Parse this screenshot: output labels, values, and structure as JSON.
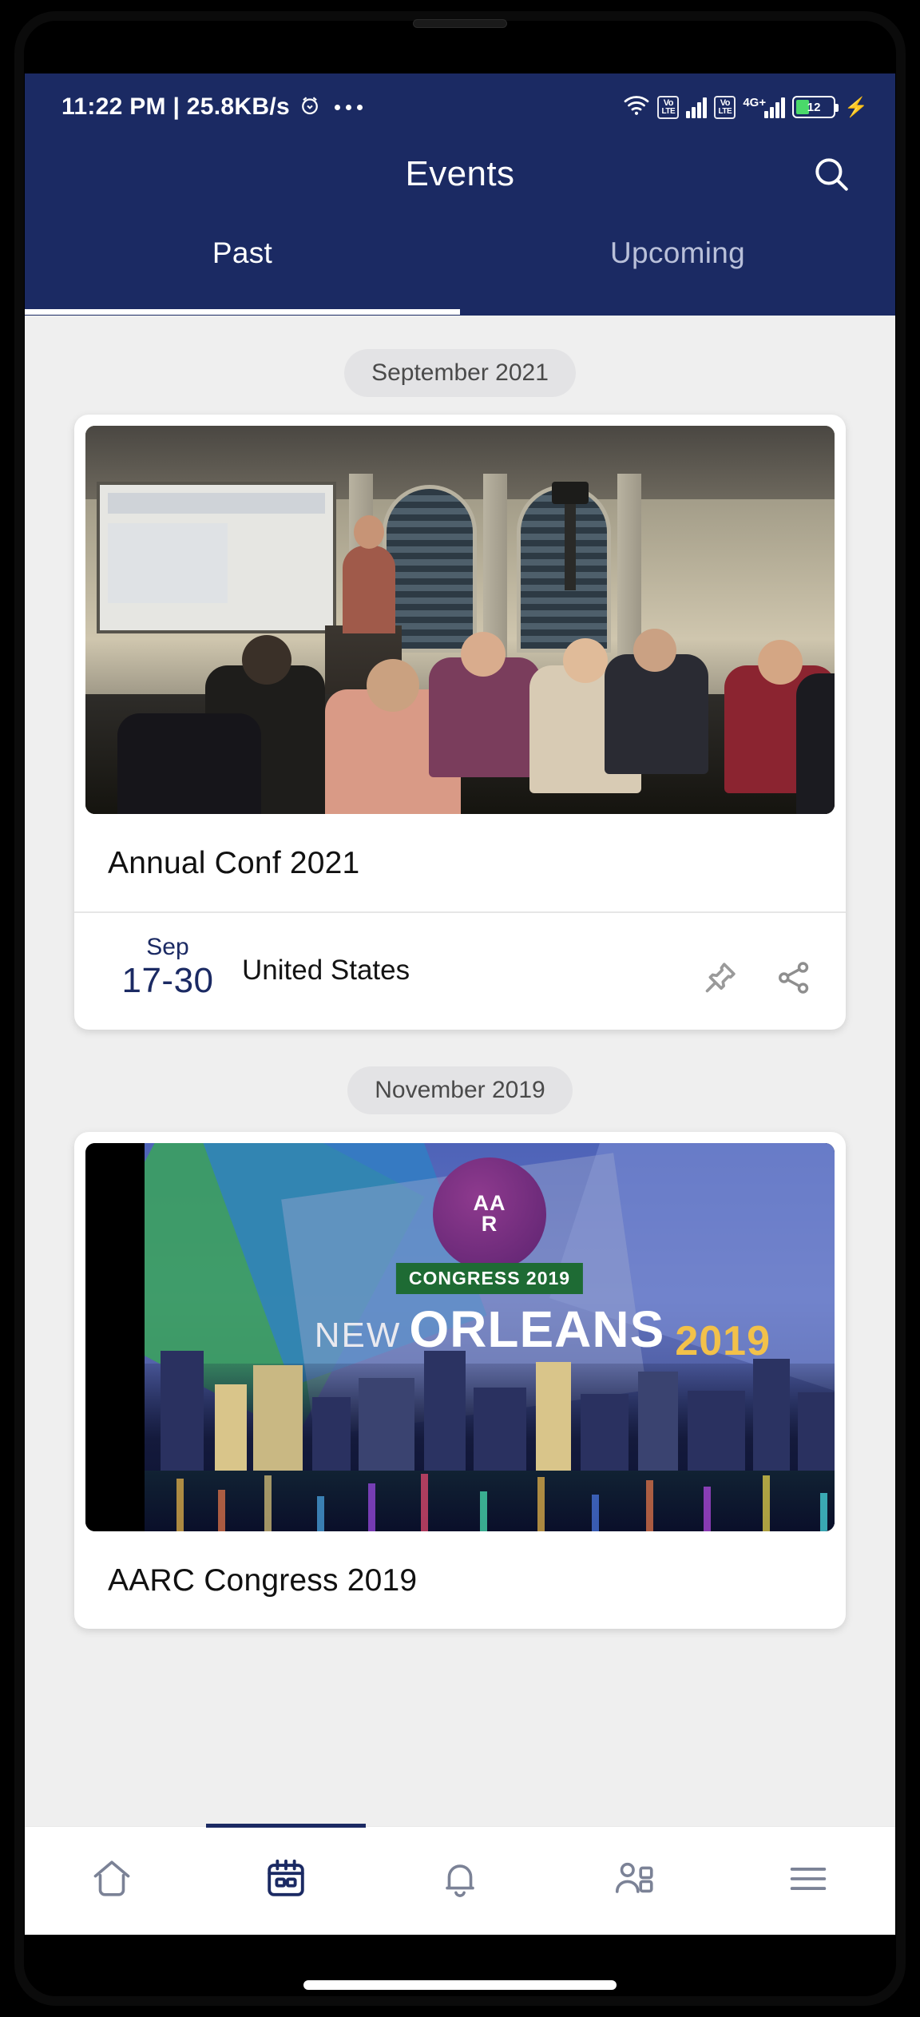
{
  "status_bar": {
    "time": "11:22 PM",
    "separator": "|",
    "net_speed": "25.8KB/s",
    "alarm_icon": "alarm-clock-icon",
    "overflow_icon": "more-dots-icon",
    "wifi_icon": "wifi-icon",
    "volte_label_top": "Vo",
    "volte_label_bottom": "LTE",
    "network_type": "4G+",
    "battery_level": "12",
    "charging_icon": "bolt-icon"
  },
  "app_bar": {
    "title": "Events",
    "search_icon": "search-icon"
  },
  "tabs": [
    {
      "label": "Past",
      "active": true
    },
    {
      "label": "Upcoming",
      "active": false
    }
  ],
  "groups": [
    {
      "month_label": "September 2021",
      "event": {
        "title": "Annual Conf 2021",
        "date_month": "Sep",
        "date_days": "17-30",
        "location": "United States",
        "pin_icon": "pin-icon",
        "share_icon": "share-icon",
        "image_alt": "conference-room-photo"
      }
    },
    {
      "month_label": "November 2019",
      "event": {
        "title": "AARC Congress 2019",
        "poster": {
          "badge_line1": "AA",
          "badge_line2": "R",
          "banner": "CONGRESS 2019",
          "city_word1": "NEW",
          "city_word2": "ORLEANS",
          "year": "2019"
        },
        "image_alt": "aarc-congress-new-orleans-poster"
      }
    }
  ],
  "bottom_nav": [
    {
      "name": "home",
      "icon": "home-icon",
      "active": false
    },
    {
      "name": "events",
      "icon": "calendar-icon",
      "active": true
    },
    {
      "name": "notifications",
      "icon": "bell-icon",
      "active": false
    },
    {
      "name": "community",
      "icon": "people-icon",
      "active": false
    },
    {
      "name": "menu",
      "icon": "hamburger-menu-icon",
      "active": false
    }
  ],
  "colors": {
    "header_navy": "#1b2a63",
    "page_bg": "#efefef",
    "accent": "#1b2a63",
    "battery_green": "#4ad96a",
    "inactive_tab": "#b9c0d9"
  }
}
